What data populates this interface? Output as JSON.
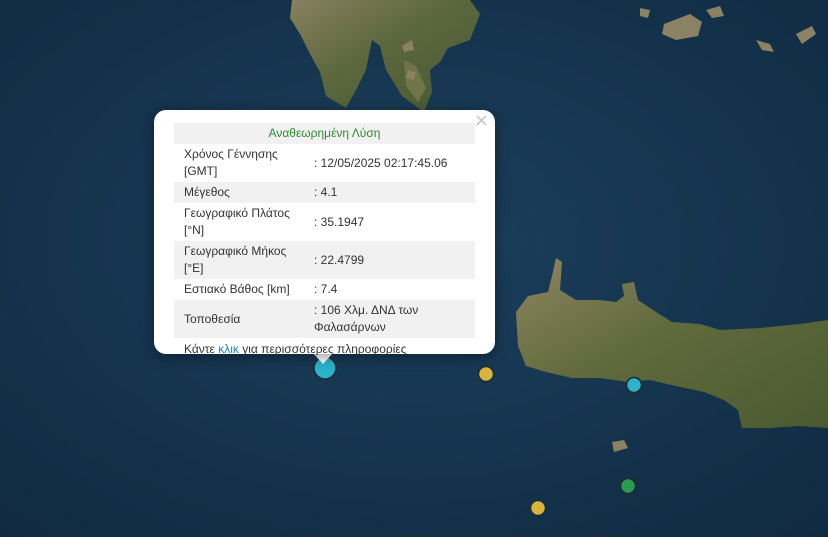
{
  "map": {
    "markers": [
      {
        "name": "selected",
        "color": "#2ab3c9"
      },
      {
        "name": "event-2",
        "color": "#d9b43a"
      },
      {
        "name": "event-3",
        "color": "#2ab3c9"
      },
      {
        "name": "event-4",
        "color": "#2a9a50"
      },
      {
        "name": "event-5",
        "color": "#d9b43a"
      }
    ]
  },
  "popup": {
    "close_glyph": "×",
    "title": "Αναθεωρημένη Λύση",
    "rows": [
      {
        "label": "Χρόνος Γέννησης [GMT]",
        "value": ": 12/05/2025 02:17:45.06"
      },
      {
        "label": "Μέγεθος",
        "value": ": 4.1"
      },
      {
        "label": "Γεωγραφικό Πλάτος [°N]",
        "value": ": 35.1947"
      },
      {
        "label": "Γεωγραφικό Μήκος [°E]",
        "value": ": 22.4799"
      },
      {
        "label": "Εστιακό Βάθος [km]",
        "value": ": 7.4"
      },
      {
        "label": "Τοποθεσία",
        "value": ": 106 Χλμ. ΔΝΔ των Φαλασάρνων"
      }
    ],
    "footer_before": "Κάντε ",
    "footer_link": "κλικ",
    "footer_after": " για περισσότερες πληροφορίες"
  }
}
